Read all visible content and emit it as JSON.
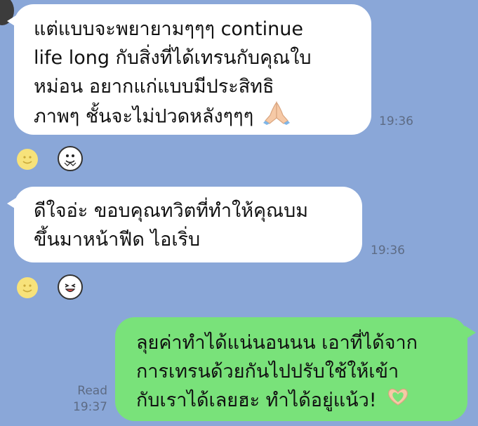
{
  "messages": [
    {
      "direction": "incoming",
      "lines": [
        "แต่แบบจะพยายามๆๆๆ continue",
        "life long กับสิ่งที่ได้เทรนกับคุณใบ",
        "หม่อน อยากแก่แบบมีประสิทธิ",
        "ภาพๆ ชั้นจะไม่ปวดหลังๆๆๆ"
      ],
      "trailing_emoji": "folded-hands-icon",
      "time": "19:36"
    },
    {
      "direction": "incoming",
      "lines": [
        "ดีใจอ่ะ ขอบคุณทวิตที่ทำให้คุณบม",
        "ขึ้นมาหน้าฟีด ไอเริ่บ"
      ],
      "time": "19:36"
    },
    {
      "direction": "outgoing",
      "lines": [
        "ลุยค่าทำได้แน่นอนนน เอาที่ได้จาก",
        "การเทรนด้วยกันไปปรับใช้ให้เข้า",
        "กับเราได้เลยฮะ ทำได้อยู่แน้ว!"
      ],
      "trailing_emoji": "heart-hands-icon",
      "status": "Read",
      "time": "19:37"
    }
  ],
  "colors": {
    "background": "#8aa7d8",
    "incoming_bubble": "#ffffff",
    "outgoing_bubble": "#79e27a",
    "timestamp": "#5d6b84"
  }
}
